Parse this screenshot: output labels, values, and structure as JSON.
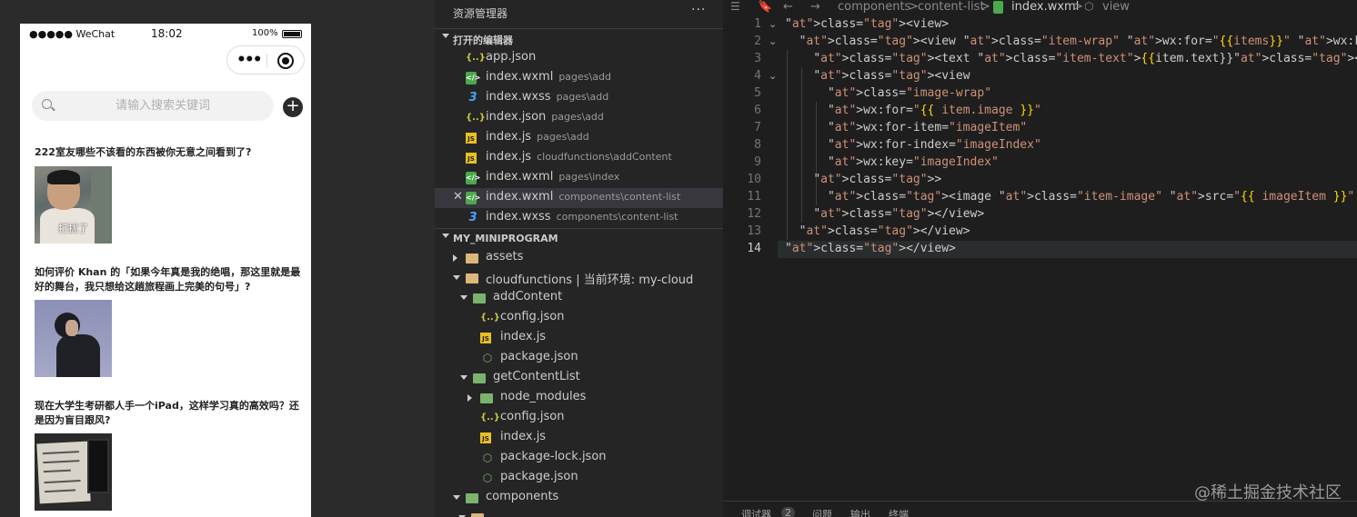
{
  "simulator": {
    "status": {
      "carrier": "●●●●● WeChat",
      "time": "18:02",
      "battery": "100%"
    },
    "capsule": {
      "more": "•••"
    },
    "search": {
      "placeholder": "请输入搜索关键词",
      "add_label": "+"
    },
    "posts": [
      {
        "title": "222室友哪些不该看的东西被你无意之间看到了?",
        "caption": "打扰了"
      },
      {
        "title": "如何评价 Khan 的「如果今年真是我的绝唱，那这里就是最好的舞台，我只想给这趟旅程画上完美的句号」?"
      },
      {
        "title": "现在大学生考研都人手一个iPad，这样学习真的高效吗？还是因为盲目跟风?"
      }
    ]
  },
  "explorer": {
    "title": "资源管理器",
    "more": "···",
    "open_editors_label": "打开的编辑器",
    "open_editors": [
      {
        "name": "app.json",
        "path": "",
        "icon": "json-icon"
      },
      {
        "name": "index.wxml",
        "path": "pages\\add",
        "icon": "wxml-icon"
      },
      {
        "name": "index.wxss",
        "path": "pages\\add",
        "icon": "wxss-icon"
      },
      {
        "name": "index.json",
        "path": "pages\\add",
        "icon": "json-icon"
      },
      {
        "name": "index.js",
        "path": "pages\\add",
        "icon": "js-icon"
      },
      {
        "name": "index.js",
        "path": "cloudfunctions\\addContent",
        "icon": "js-icon"
      },
      {
        "name": "index.wxml",
        "path": "pages\\index",
        "icon": "wxml-icon"
      },
      {
        "name": "index.wxml",
        "path": "components\\content-list",
        "icon": "wxml-icon",
        "active": true
      },
      {
        "name": "index.wxss",
        "path": "components\\content-list",
        "icon": "wxss-icon"
      }
    ],
    "close_glyph": "✕",
    "project_label": "MY_MINIPROGRAM",
    "tree": [
      {
        "name": "assets",
        "type": "folder",
        "indent": 0,
        "twisty": "r"
      },
      {
        "name": "cloudfunctions | 当前环境: my-cloud",
        "type": "folder",
        "indent": 0,
        "twisty": "d"
      },
      {
        "name": "addContent",
        "type": "gfolder",
        "indent": 1,
        "twisty": "d"
      },
      {
        "name": "config.json",
        "type": "json",
        "indent": 2,
        "twisty": ""
      },
      {
        "name": "index.js",
        "type": "js",
        "indent": 2,
        "twisty": ""
      },
      {
        "name": "package.json",
        "type": "pkg",
        "indent": 2,
        "twisty": ""
      },
      {
        "name": "getContentList",
        "type": "gfolder",
        "indent": 1,
        "twisty": "d"
      },
      {
        "name": "node_modules",
        "type": "gfolder",
        "indent": 2,
        "twisty": "r"
      },
      {
        "name": "config.json",
        "type": "json",
        "indent": 2,
        "twisty": ""
      },
      {
        "name": "index.js",
        "type": "js",
        "indent": 2,
        "twisty": ""
      },
      {
        "name": "package-lock.json",
        "type": "pkg",
        "indent": 2,
        "twisty": ""
      },
      {
        "name": "package.json",
        "type": "pkg",
        "indent": 2,
        "twisty": ""
      },
      {
        "name": "components",
        "type": "gfolder",
        "indent": 0,
        "twisty": "d"
      }
    ]
  },
  "editor": {
    "breadcrumb": [
      "components",
      "content-list",
      "index.wxml",
      "view"
    ],
    "breadcrumb_sep": ">",
    "current_line": 14,
    "lines": [
      "<view>",
      "  <view class=\"item-wrap\" wx:for=\"{{items}}\" wx:key=\"index\">",
      "    <text class=\"item-text\">{{item.text}}</text>",
      "    <view",
      "      class=\"image-wrap\"",
      "      wx:for=\"{{ item.image }}\"",
      "      wx:for-item=\"imageItem\"",
      "      wx:for-index=\"imageIndex\"",
      "      wx:key=\"imageIndex\"",
      "    >",
      "      <image class=\"item-image\" src=\"{{ imageItem }}\" mode=\"aspectFill\"></image>",
      "    </view>",
      "  </view>",
      "</view>"
    ],
    "panel_tabs": [
      "调试器",
      "2",
      "问题",
      "输出",
      "终端"
    ]
  },
  "watermark": "@稀土掘金技术社区"
}
